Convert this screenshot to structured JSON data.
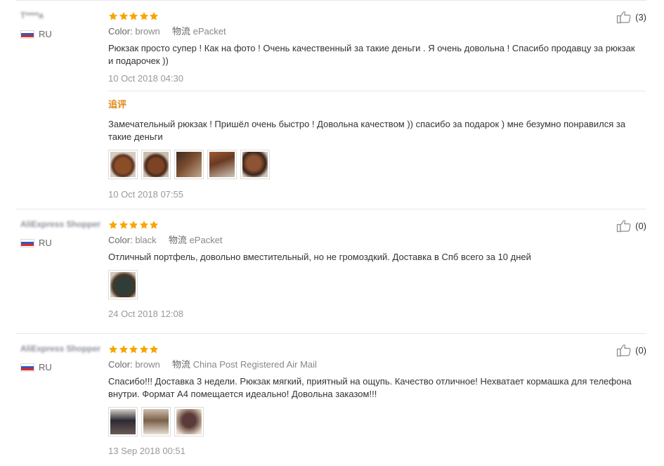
{
  "colors": {
    "star": "#f7a600",
    "additional_label": "#e08a1b",
    "separator": "#e8e8e8",
    "date": "#999999"
  },
  "reviews": [
    {
      "user": "T****a",
      "country": "RU",
      "stars": 5,
      "color_label": "Color:",
      "color_value": "brown",
      "logistics_label": "物流",
      "logistics_value": "ePacket",
      "text": "Рюкзак просто супер ! Как на фото ! Очень качественный за такие деньги . Я очень довольна ! Спасибо продавцу за рюкзак и подарочек ))",
      "date": "10 Oct 2018 04:30",
      "useful_count": "(3)",
      "additional": {
        "label": "追评",
        "text": "Замечательный рюкзак ! Пришёл очень быстро ! Довольна качеством )) спасибо за подарок ) мне безумно понравился за такие деньги",
        "photos": [
          "backpack-photo",
          "backpack-photo",
          "backpack-photo",
          "backpack-photo",
          "backpack-photo"
        ],
        "date": "10 Oct 2018 07:55"
      }
    },
    {
      "user": "AliExpress Shopper",
      "country": "RU",
      "stars": 5,
      "color_label": "Color:",
      "color_value": "black",
      "logistics_label": "物流",
      "logistics_value": "ePacket",
      "text": "Отличный портфель, довольно вместительный, но не громоздкий. Доставка в Спб всего за 10 дней",
      "photos": [
        "backpack-photo"
      ],
      "date": "24 Oct 2018 12:08",
      "useful_count": "(0)"
    },
    {
      "user": "AliExpress Shopper",
      "country": "RU",
      "stars": 5,
      "color_label": "Color:",
      "color_value": "brown",
      "logistics_label": "物流",
      "logistics_value": "China Post Registered Air Mail",
      "text": "Спасибо!!! Доставка 3 недели. Рюкзак мягкий, приятный на ощупь. Качество отличное! Нехватает кормашка для телефона внутри. Формат А4 помещается идеально! Довольна заказом!!!",
      "photos": [
        "backpack-photo",
        "backpack-photo",
        "backpack-photo"
      ],
      "date": "13 Sep 2018 00:51",
      "useful_count": "(0)"
    }
  ]
}
